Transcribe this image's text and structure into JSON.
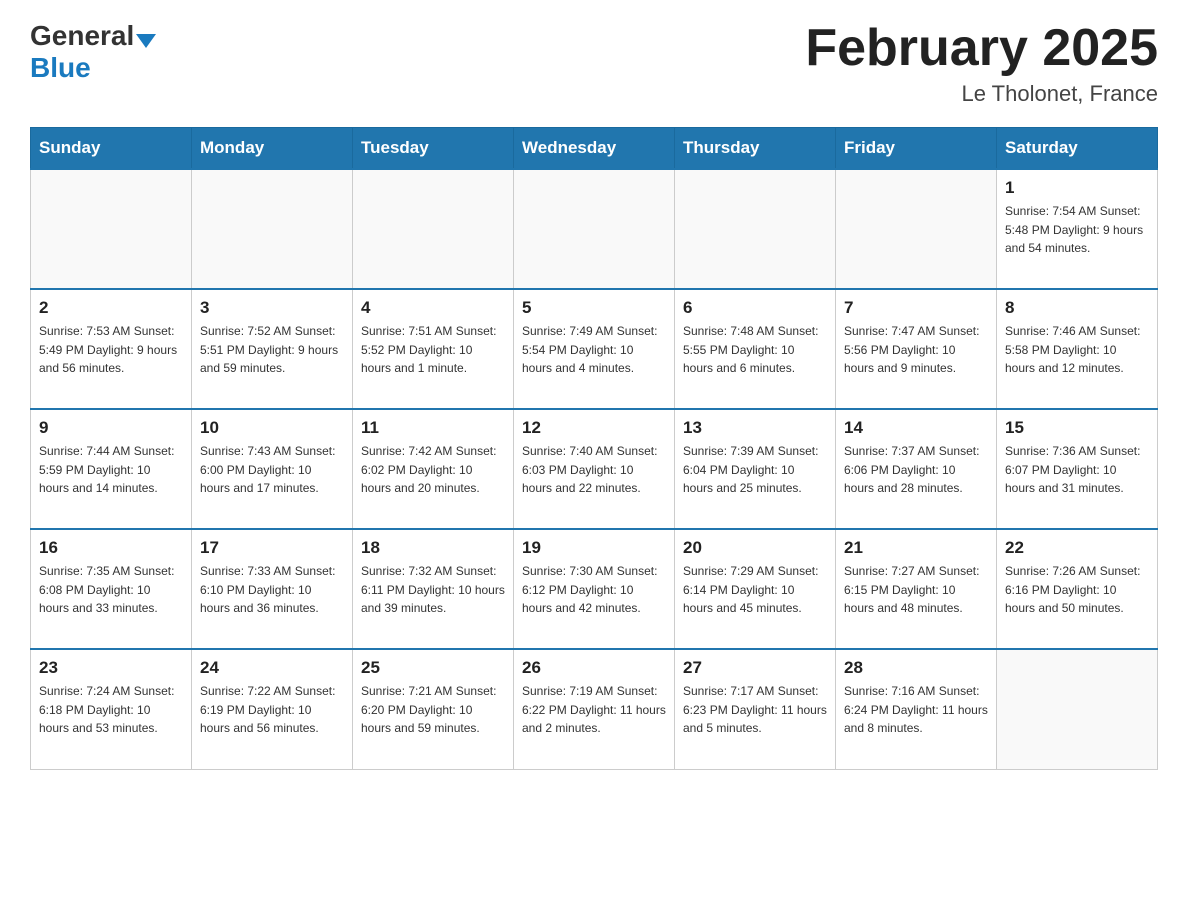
{
  "header": {
    "logo_general": "General",
    "logo_blue": "Blue",
    "month_title": "February 2025",
    "location": "Le Tholonet, France"
  },
  "days_of_week": [
    "Sunday",
    "Monday",
    "Tuesday",
    "Wednesday",
    "Thursday",
    "Friday",
    "Saturday"
  ],
  "weeks": [
    [
      {
        "day": "",
        "info": ""
      },
      {
        "day": "",
        "info": ""
      },
      {
        "day": "",
        "info": ""
      },
      {
        "day": "",
        "info": ""
      },
      {
        "day": "",
        "info": ""
      },
      {
        "day": "",
        "info": ""
      },
      {
        "day": "1",
        "info": "Sunrise: 7:54 AM\nSunset: 5:48 PM\nDaylight: 9 hours and 54 minutes."
      }
    ],
    [
      {
        "day": "2",
        "info": "Sunrise: 7:53 AM\nSunset: 5:49 PM\nDaylight: 9 hours and 56 minutes."
      },
      {
        "day": "3",
        "info": "Sunrise: 7:52 AM\nSunset: 5:51 PM\nDaylight: 9 hours and 59 minutes."
      },
      {
        "day": "4",
        "info": "Sunrise: 7:51 AM\nSunset: 5:52 PM\nDaylight: 10 hours and 1 minute."
      },
      {
        "day": "5",
        "info": "Sunrise: 7:49 AM\nSunset: 5:54 PM\nDaylight: 10 hours and 4 minutes."
      },
      {
        "day": "6",
        "info": "Sunrise: 7:48 AM\nSunset: 5:55 PM\nDaylight: 10 hours and 6 minutes."
      },
      {
        "day": "7",
        "info": "Sunrise: 7:47 AM\nSunset: 5:56 PM\nDaylight: 10 hours and 9 minutes."
      },
      {
        "day": "8",
        "info": "Sunrise: 7:46 AM\nSunset: 5:58 PM\nDaylight: 10 hours and 12 minutes."
      }
    ],
    [
      {
        "day": "9",
        "info": "Sunrise: 7:44 AM\nSunset: 5:59 PM\nDaylight: 10 hours and 14 minutes."
      },
      {
        "day": "10",
        "info": "Sunrise: 7:43 AM\nSunset: 6:00 PM\nDaylight: 10 hours and 17 minutes."
      },
      {
        "day": "11",
        "info": "Sunrise: 7:42 AM\nSunset: 6:02 PM\nDaylight: 10 hours and 20 minutes."
      },
      {
        "day": "12",
        "info": "Sunrise: 7:40 AM\nSunset: 6:03 PM\nDaylight: 10 hours and 22 minutes."
      },
      {
        "day": "13",
        "info": "Sunrise: 7:39 AM\nSunset: 6:04 PM\nDaylight: 10 hours and 25 minutes."
      },
      {
        "day": "14",
        "info": "Sunrise: 7:37 AM\nSunset: 6:06 PM\nDaylight: 10 hours and 28 minutes."
      },
      {
        "day": "15",
        "info": "Sunrise: 7:36 AM\nSunset: 6:07 PM\nDaylight: 10 hours and 31 minutes."
      }
    ],
    [
      {
        "day": "16",
        "info": "Sunrise: 7:35 AM\nSunset: 6:08 PM\nDaylight: 10 hours and 33 minutes."
      },
      {
        "day": "17",
        "info": "Sunrise: 7:33 AM\nSunset: 6:10 PM\nDaylight: 10 hours and 36 minutes."
      },
      {
        "day": "18",
        "info": "Sunrise: 7:32 AM\nSunset: 6:11 PM\nDaylight: 10 hours and 39 minutes."
      },
      {
        "day": "19",
        "info": "Sunrise: 7:30 AM\nSunset: 6:12 PM\nDaylight: 10 hours and 42 minutes."
      },
      {
        "day": "20",
        "info": "Sunrise: 7:29 AM\nSunset: 6:14 PM\nDaylight: 10 hours and 45 minutes."
      },
      {
        "day": "21",
        "info": "Sunrise: 7:27 AM\nSunset: 6:15 PM\nDaylight: 10 hours and 48 minutes."
      },
      {
        "day": "22",
        "info": "Sunrise: 7:26 AM\nSunset: 6:16 PM\nDaylight: 10 hours and 50 minutes."
      }
    ],
    [
      {
        "day": "23",
        "info": "Sunrise: 7:24 AM\nSunset: 6:18 PM\nDaylight: 10 hours and 53 minutes."
      },
      {
        "day": "24",
        "info": "Sunrise: 7:22 AM\nSunset: 6:19 PM\nDaylight: 10 hours and 56 minutes."
      },
      {
        "day": "25",
        "info": "Sunrise: 7:21 AM\nSunset: 6:20 PM\nDaylight: 10 hours and 59 minutes."
      },
      {
        "day": "26",
        "info": "Sunrise: 7:19 AM\nSunset: 6:22 PM\nDaylight: 11 hours and 2 minutes."
      },
      {
        "day": "27",
        "info": "Sunrise: 7:17 AM\nSunset: 6:23 PM\nDaylight: 11 hours and 5 minutes."
      },
      {
        "day": "28",
        "info": "Sunrise: 7:16 AM\nSunset: 6:24 PM\nDaylight: 11 hours and 8 minutes."
      },
      {
        "day": "",
        "info": ""
      }
    ]
  ]
}
